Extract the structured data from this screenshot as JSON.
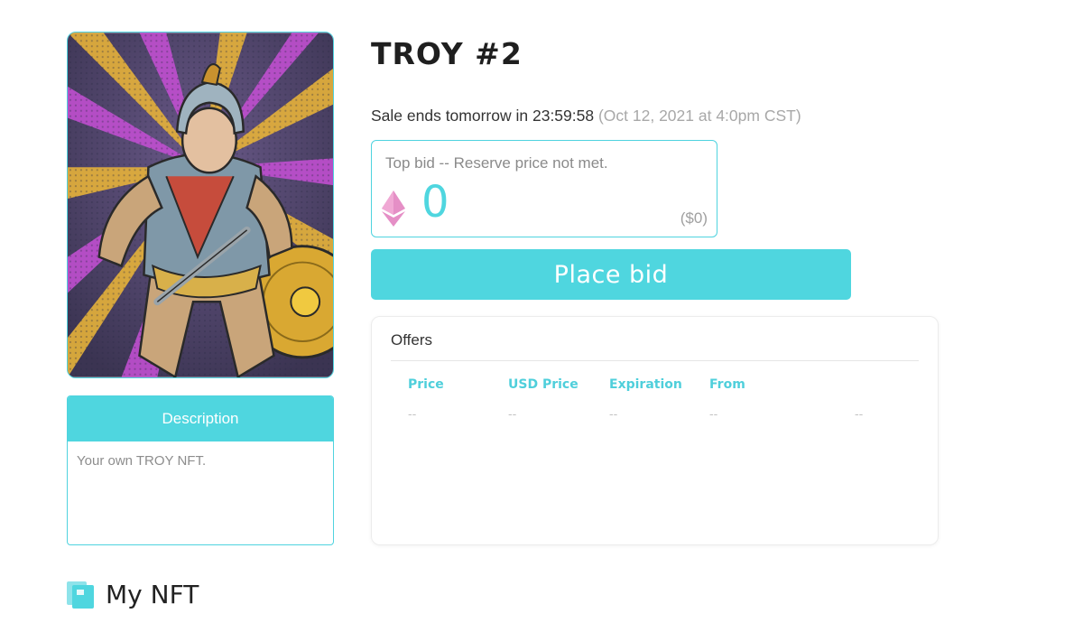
{
  "nft": {
    "title": "TROY #2",
    "image_alt": "Trojan warrior comic artwork"
  },
  "description": {
    "header": "Description",
    "text": "Your own TROY NFT."
  },
  "sale": {
    "ends_text": "Sale ends tomorrow in 23:59:58",
    "ends_date": "(Oct 12, 2021 at 4:0pm CST)"
  },
  "bid": {
    "label": "Top bid -- Reserve price not met.",
    "amount": "0",
    "usd": "($0)",
    "currency_icon": "ethereum-icon",
    "place_bid_label": "Place bid"
  },
  "offers": {
    "title": "Offers",
    "columns": [
      "Price",
      "USD Price",
      "Expiration",
      "From"
    ],
    "rows": [
      [
        "--",
        "--",
        "--",
        "--",
        "--"
      ]
    ]
  },
  "section": {
    "my_nft_label": "My NFT",
    "icon": "gallery-icon"
  },
  "colors": {
    "accent": "#4fd6df",
    "eth_icon": "#e58fc6",
    "muted_text": "#a0a0a0"
  }
}
